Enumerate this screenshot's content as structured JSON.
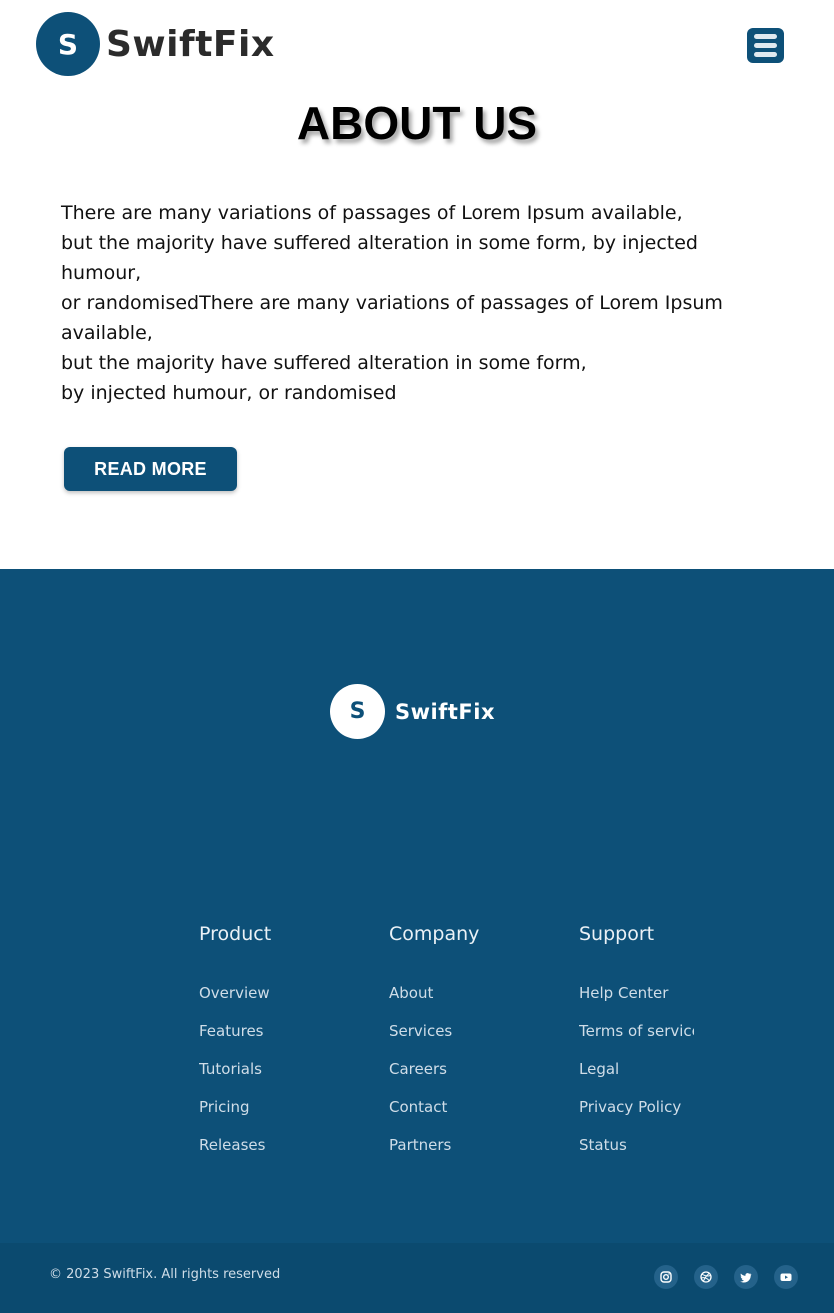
{
  "header": {
    "logo_letter": "S",
    "logo_text": "SwiftFix",
    "menu_icon": "hamburger-menu-icon"
  },
  "about": {
    "title": "ABOUT US",
    "lines": [
      "There are many variations of passages of Lorem Ipsum available,",
      "but the majority have suffered alteration in some form, by injected humour,",
      "or randomisedThere are many variations of passages of Lorem Ipsum available,",
      "but the majority have suffered alteration in some form,",
      "by injected humour, or randomised"
    ],
    "button_label": "READ MORE"
  },
  "footer": {
    "logo_letter": "S",
    "logo_text": "SwiftFix",
    "columns": [
      {
        "title": "Product",
        "links": [
          "Overview",
          "Features",
          "Tutorials",
          "Pricing",
          "Releases"
        ]
      },
      {
        "title": "Company",
        "links": [
          "About",
          "Services",
          "Careers",
          "Contact",
          "Partners"
        ]
      },
      {
        "title": "Support",
        "links": [
          "Help Center",
          "Terms of service",
          "Legal",
          "Privacy Policy",
          "Status"
        ]
      }
    ],
    "copyright": "© 2023 SwiftFix. All rights reserved",
    "social": [
      "instagram-icon",
      "dribbble-icon",
      "twitter-icon",
      "youtube-icon"
    ]
  },
  "colors": {
    "brand": "#0d5078",
    "bottom_bar": "#0b4a6f"
  }
}
